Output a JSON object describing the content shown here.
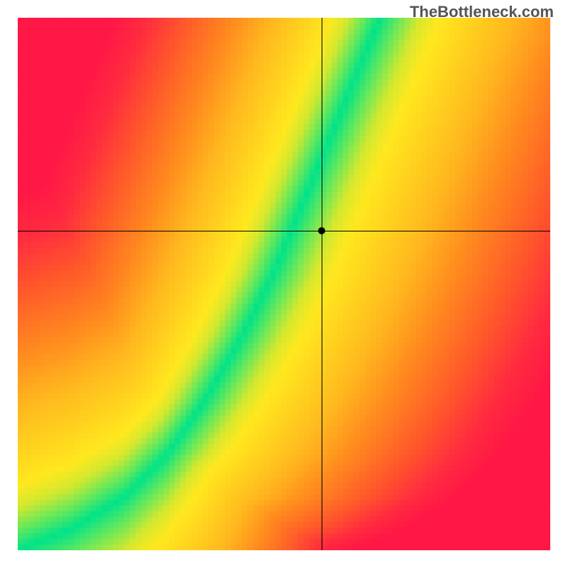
{
  "watermark": "TheBottleneck.com",
  "chart_data": {
    "type": "heatmap",
    "title": "",
    "xlabel": "",
    "ylabel": "",
    "xlim": [
      0,
      100
    ],
    "ylim": [
      0,
      100
    ],
    "crosshair": {
      "x": 57,
      "y": 60
    },
    "marker": {
      "x": 57,
      "y": 60
    },
    "optimal_curve": [
      {
        "x": 0,
        "y": 0
      },
      {
        "x": 10,
        "y": 4
      },
      {
        "x": 20,
        "y": 10
      },
      {
        "x": 28,
        "y": 18
      },
      {
        "x": 35,
        "y": 28
      },
      {
        "x": 42,
        "y": 40
      },
      {
        "x": 48,
        "y": 52
      },
      {
        "x": 53,
        "y": 64
      },
      {
        "x": 58,
        "y": 76
      },
      {
        "x": 63,
        "y": 88
      },
      {
        "x": 68,
        "y": 100
      }
    ],
    "color_scale": [
      {
        "distance": 0.0,
        "color": "#00e38a"
      },
      {
        "distance": 0.06,
        "color": "#6ae85a"
      },
      {
        "distance": 0.12,
        "color": "#d4e82f"
      },
      {
        "distance": 0.18,
        "color": "#ffe81f"
      },
      {
        "distance": 0.28,
        "color": "#ffd21f"
      },
      {
        "distance": 0.4,
        "color": "#ffb81f"
      },
      {
        "distance": 0.55,
        "color": "#ff8a1f"
      },
      {
        "distance": 0.72,
        "color": "#ff5a2a"
      },
      {
        "distance": 0.88,
        "color": "#ff2a40"
      },
      {
        "distance": 1.0,
        "color": "#ff1846"
      }
    ],
    "grid_resolution": 95
  }
}
